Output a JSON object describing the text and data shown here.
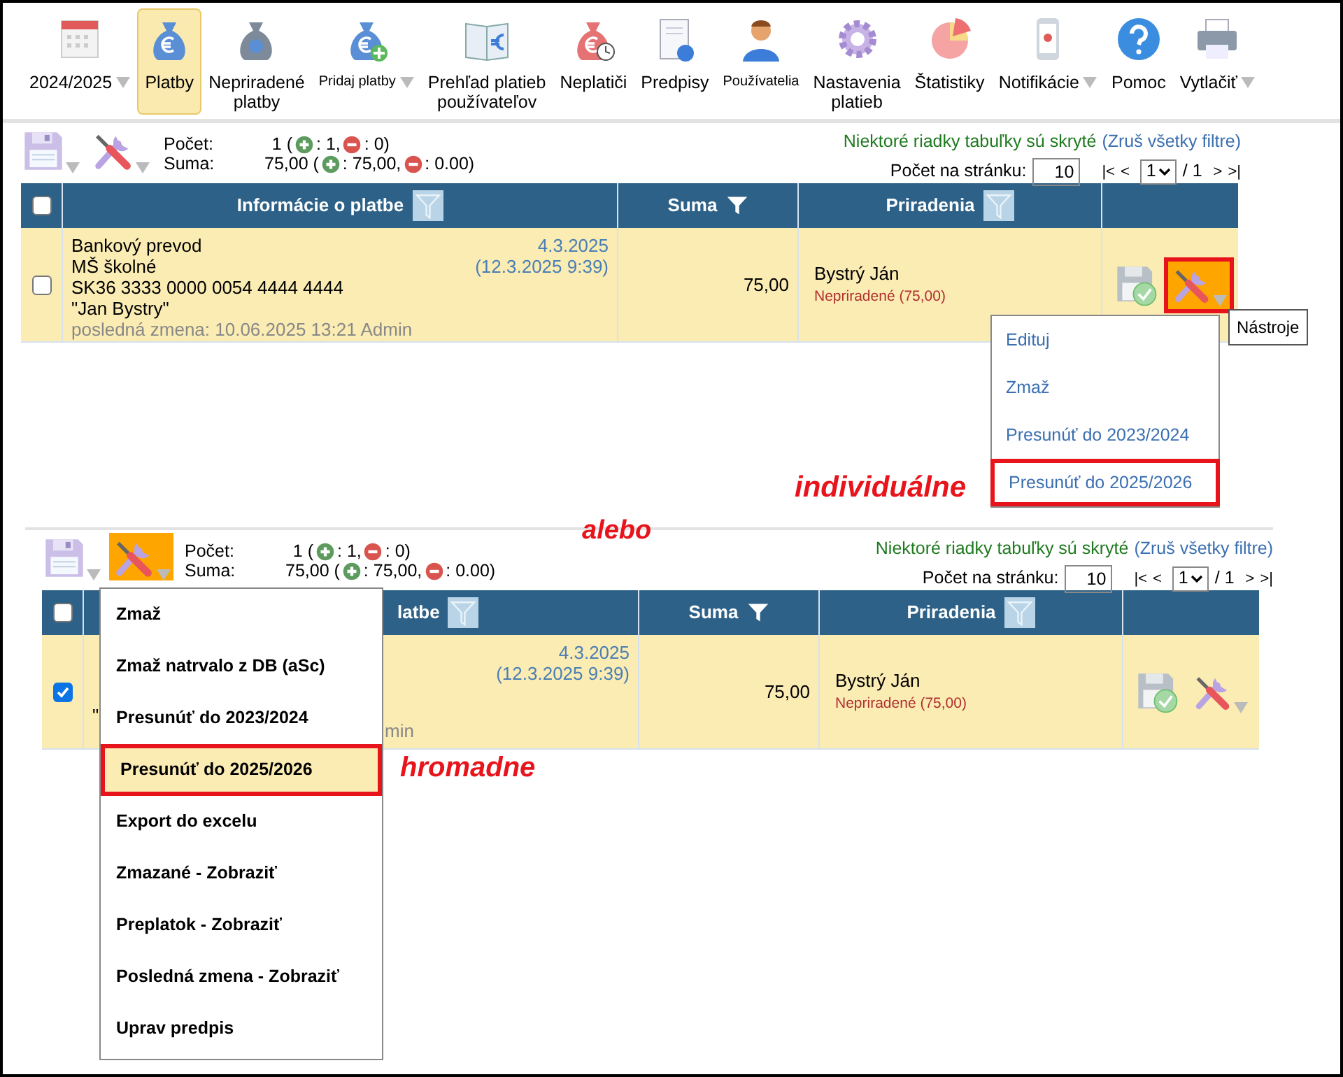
{
  "toolbar": {
    "items": [
      {
        "label": "2024/2025",
        "selected": false,
        "dropdown": true
      },
      {
        "label": "Platby",
        "selected": true,
        "dropdown": false
      },
      {
        "label": "Nepriradené\nplatby",
        "selected": false,
        "dropdown": false
      },
      {
        "label": "Pridaj platby",
        "selected": false,
        "dropdown": true
      },
      {
        "label": "Prehľad platieb\npoužívateľov",
        "selected": false,
        "dropdown": false
      },
      {
        "label": "Neplatiči",
        "selected": false,
        "dropdown": false
      },
      {
        "label": "Predpisy",
        "selected": false,
        "dropdown": false
      },
      {
        "label": "Používatelia",
        "selected": false,
        "dropdown": false
      },
      {
        "label": "Nastavenia\nplatieb",
        "selected": false,
        "dropdown": false
      },
      {
        "label": "Štatistiky",
        "selected": false,
        "dropdown": false
      },
      {
        "label": "Notifikácie",
        "selected": false,
        "dropdown": true
      },
      {
        "label": "Pomoc",
        "selected": false,
        "dropdown": false
      },
      {
        "label": "Vytlačiť",
        "selected": false,
        "dropdown": true
      }
    ]
  },
  "panels": [
    {
      "tools_open": false,
      "count": {
        "label": "Počet:",
        "parts": [
          "1 (",
          ": 1,",
          ": 0)"
        ]
      },
      "sum": {
        "label": "Suma:",
        "parts": [
          "75,00 (",
          ": 75,00,",
          ": 0.00)"
        ]
      },
      "filter_note": "Niektoré riadky tabuľky sú skryté",
      "filter_link": "(Zruš všetky filtre)",
      "per_page_label": "Počet na stránku:",
      "per_page": "10",
      "pager": {
        "first": "|<",
        "prev": "<",
        "page": "1",
        "total": "/ 1",
        "next": ">",
        "last": ">|"
      },
      "header_checked": false,
      "columns": [
        {
          "label": "Informácie o platbe",
          "filter_active": false
        },
        {
          "label": "Suma",
          "filter_active": true
        },
        {
          "label": "Priradenia",
          "filter_active": false
        }
      ],
      "rows": [
        {
          "checked": false,
          "info": [
            "Bankový prevod",
            "MŠ školné",
            "SK36 3333 0000 0054 4444 4444",
            "\"Jan Bystry\""
          ],
          "changed": "posledná zmena: 10.06.2025 13:21 Admin",
          "date": "4.3.2025",
          "datetime": "(12.3.2025 9:39)",
          "amount": "75,00",
          "assignee": "Bystrý Ján",
          "assignment": "Nepriradené (75,00)",
          "tools_highlighted": true
        }
      ],
      "row_menu": {
        "items": [
          {
            "label": "Edituj",
            "highlighted": false
          },
          {
            "label": "Zmaž",
            "highlighted": false
          },
          {
            "label": "Presunúť do 2023/2024",
            "highlighted": false
          },
          {
            "label": "Presunúť do 2025/2026",
            "highlighted": true
          }
        ],
        "tooltip": "Nástroje"
      }
    },
    {
      "tools_open": true,
      "count": {
        "label": "Počet:",
        "parts": [
          "1 (",
          ": 1,",
          ": 0)"
        ]
      },
      "sum": {
        "label": "Suma:",
        "parts": [
          "75,00 (",
          ": 75,00,",
          ": 0.00)"
        ]
      },
      "filter_note": "Niektoré riadky tabuľky sú skryté",
      "filter_link": "(Zruš všetky filtre)",
      "per_page_label": "Počet na stránku:",
      "per_page": "10",
      "pager": {
        "first": "|<",
        "prev": "<",
        "page": "1",
        "total": "/ 1",
        "next": ">",
        "last": ">|"
      },
      "header_checked": false,
      "columns": [
        {
          "label": "latbe",
          "filter_active": false
        },
        {
          "label": "Suma",
          "filter_active": true
        },
        {
          "label": "Priradenia",
          "filter_active": false
        }
      ],
      "rows": [
        {
          "checked": true,
          "info": [
            "\""
          ],
          "info_tail": "min",
          "date": "4.3.2025",
          "datetime": "(12.3.2025 9:39)",
          "amount": "75,00",
          "assignee": "Bystrý Ján",
          "assignment": "Nepriradené (75,00)",
          "tools_highlighted": false
        }
      ],
      "bulk_menu": {
        "items": [
          {
            "label": "Zmaž",
            "highlighted": false
          },
          {
            "label": "Zmaž natrvalo z DB (aSc)",
            "highlighted": false
          },
          {
            "label": "Presunúť do 2023/2024",
            "highlighted": false
          },
          {
            "label": "Presunúť do 2025/2026",
            "highlighted": true
          },
          {
            "label": "Export do excelu",
            "highlighted": false
          },
          {
            "label": "Zmazané - Zobraziť",
            "highlighted": false
          },
          {
            "label": "Preplatok - Zobraziť",
            "highlighted": false
          },
          {
            "label": "Posledná zmena - Zobraziť",
            "highlighted": false
          },
          {
            "label": "Uprav predpis",
            "highlighted": false
          }
        ]
      }
    }
  ],
  "annotations": [
    {
      "text": "individuálne"
    },
    {
      "text": "alebo"
    },
    {
      "text": "hromadne"
    }
  ]
}
